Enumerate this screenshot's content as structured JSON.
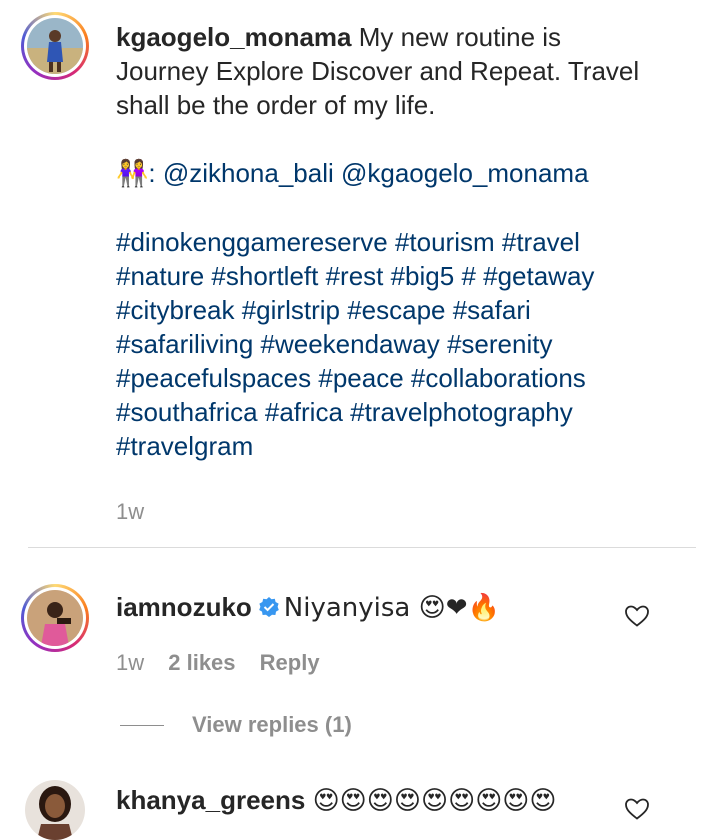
{
  "post": {
    "username": "kgaogelo_monama",
    "caption_line1": " My new routine is",
    "caption_line2": "Journey Explore Discover and Repeat. Travel",
    "caption_line3": "shall be the order of my life.",
    "credit_emoji": "👭",
    "credit_text": ": @zikhona_bali @kgaogelo_monama",
    "hashtag_lines": [
      "#dinokenggamereserve #tourism #travel",
      "#nature #shortleft #rest #big5 # #getaway",
      "#citybreak #girlstrip #escape #safari",
      "#safariliving #weekendaway #serenity",
      "#peacefulspaces #peace #collaborations",
      "#southafrica #africa #travelphotography",
      "#travelgram"
    ],
    "time": "1w"
  },
  "comments": [
    {
      "username": "iamnozuko",
      "text": "Niyanyisa 😍❤🔥",
      "time": "1w",
      "likes": "2 likes",
      "reply_label": "Reply",
      "view_replies": "View replies (1)"
    },
    {
      "username": "khanya_greens",
      "text": "😍😍😍😍😍😍😍😍😍"
    }
  ],
  "icons": {
    "like": "heart-outline-icon",
    "verified": "verified-badge-icon"
  },
  "colors": {
    "hashtag": "#00376b",
    "meta": "#8e8e8e",
    "verified": "#3897f0"
  }
}
